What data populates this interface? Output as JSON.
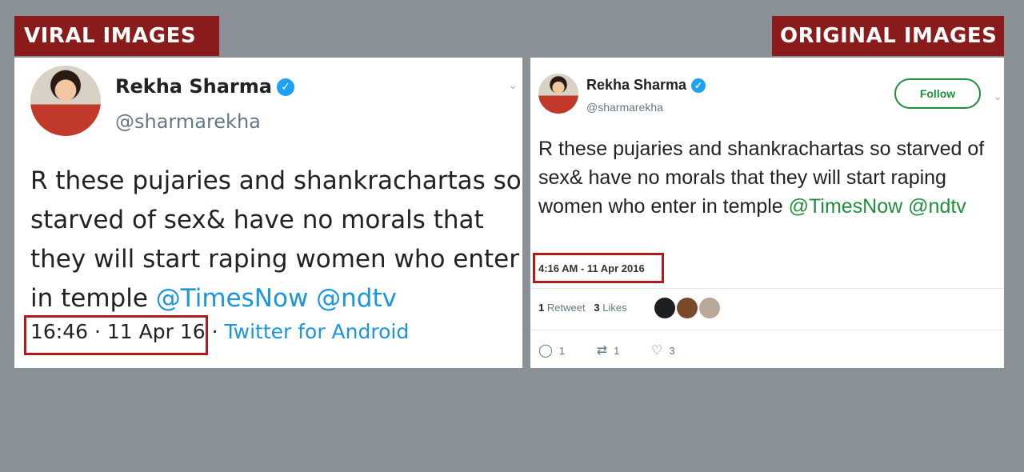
{
  "banners": {
    "left": "VIRAL IMAGES",
    "right": "ORIGINAL IMAGES"
  },
  "viral": {
    "name": "Rekha Sharma",
    "handle": "@sharmarekha",
    "tweet_text": "R these pujaries and shankrachartas so starved of sex& have no morals that they will start raping women who enter in temple ",
    "mentions": [
      "@TimesNow",
      "@ndtv"
    ],
    "time": "16:46 · 11 Apr 16 ·",
    "source": " Twitter for Android"
  },
  "original": {
    "name": "Rekha Sharma",
    "handle": "@sharmarekha",
    "follow_label": "Follow",
    "tweet_text": "R these pujaries and shankrachartas so starved of sex& have no morals that they will start raping women who enter in temple ",
    "mentions": [
      "@TimesNow",
      "@ndtv"
    ],
    "timestamp": "4:16 AM - 11 Apr 2016",
    "retweets_count": "1",
    "retweets_label": "Retweet",
    "likes_count": "3",
    "likes_label": "Likes",
    "reply_count": "1",
    "retweet_action_count": "1",
    "like_action_count": "3"
  },
  "colors": {
    "banner": "#8b1a1a",
    "highlight_box": "#b01c1c",
    "viral_link": "#1b95e0",
    "original_link": "#1f8f3a",
    "verified": "#1da1f2"
  },
  "icons": {
    "verified": "verified-badge-icon",
    "chevron": "chevron-down-icon",
    "reply": "reply-icon",
    "retweet": "retweet-icon",
    "like": "heart-icon"
  }
}
